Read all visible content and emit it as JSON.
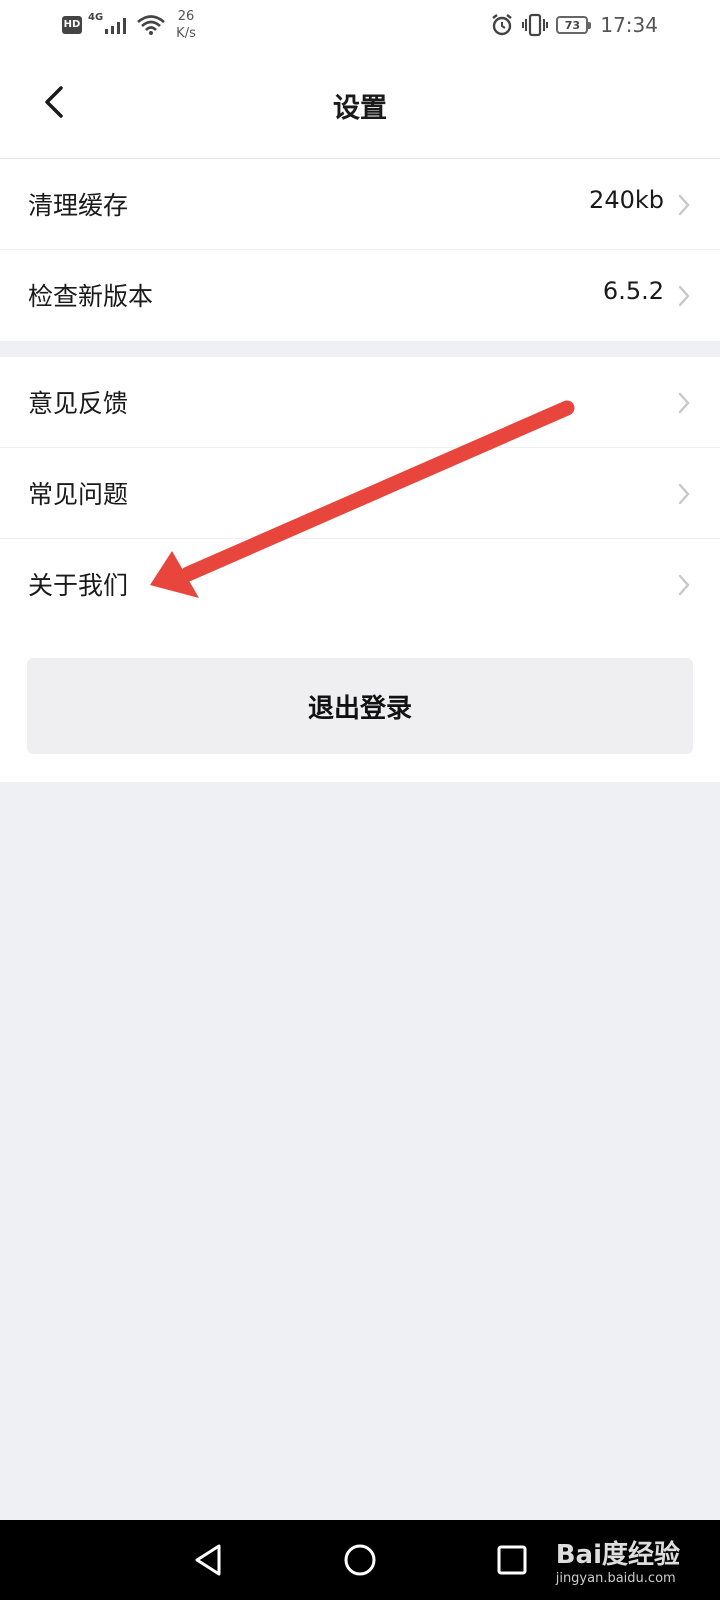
{
  "status_bar": {
    "hd_badge": "HD",
    "network_type": "4G",
    "speed_value": "26",
    "speed_unit": "K/s",
    "battery_level": "73",
    "time": "17:34",
    "icons": [
      "signal-icon",
      "wifi-icon",
      "alarm-icon",
      "vibrate-icon",
      "battery-icon"
    ]
  },
  "header": {
    "title": "设置",
    "back_icon": "chevron-left-icon"
  },
  "settings": {
    "group1": [
      {
        "label": "清理缓存",
        "value": "240kb"
      },
      {
        "label": "检查新版本",
        "value": "6.5.2"
      }
    ],
    "group2": [
      {
        "label": "意见反馈",
        "value": ""
      },
      {
        "label": "常见问题",
        "value": ""
      },
      {
        "label": "关于我们",
        "value": ""
      }
    ]
  },
  "logout": {
    "label": "退出登录"
  },
  "annotation": {
    "color": "#e8453c",
    "points_to": "关于我们"
  },
  "system_nav": {
    "icons": [
      "nav-back-icon",
      "nav-home-icon",
      "nav-recent-icon"
    ]
  },
  "watermark": {
    "brand": "Bai度经验",
    "url": "jingyan.baidu.com"
  },
  "colors": {
    "background": "#eef0f4",
    "surface": "#ffffff",
    "button_bg": "#efeff2",
    "chevron": "#c8c8c8"
  }
}
